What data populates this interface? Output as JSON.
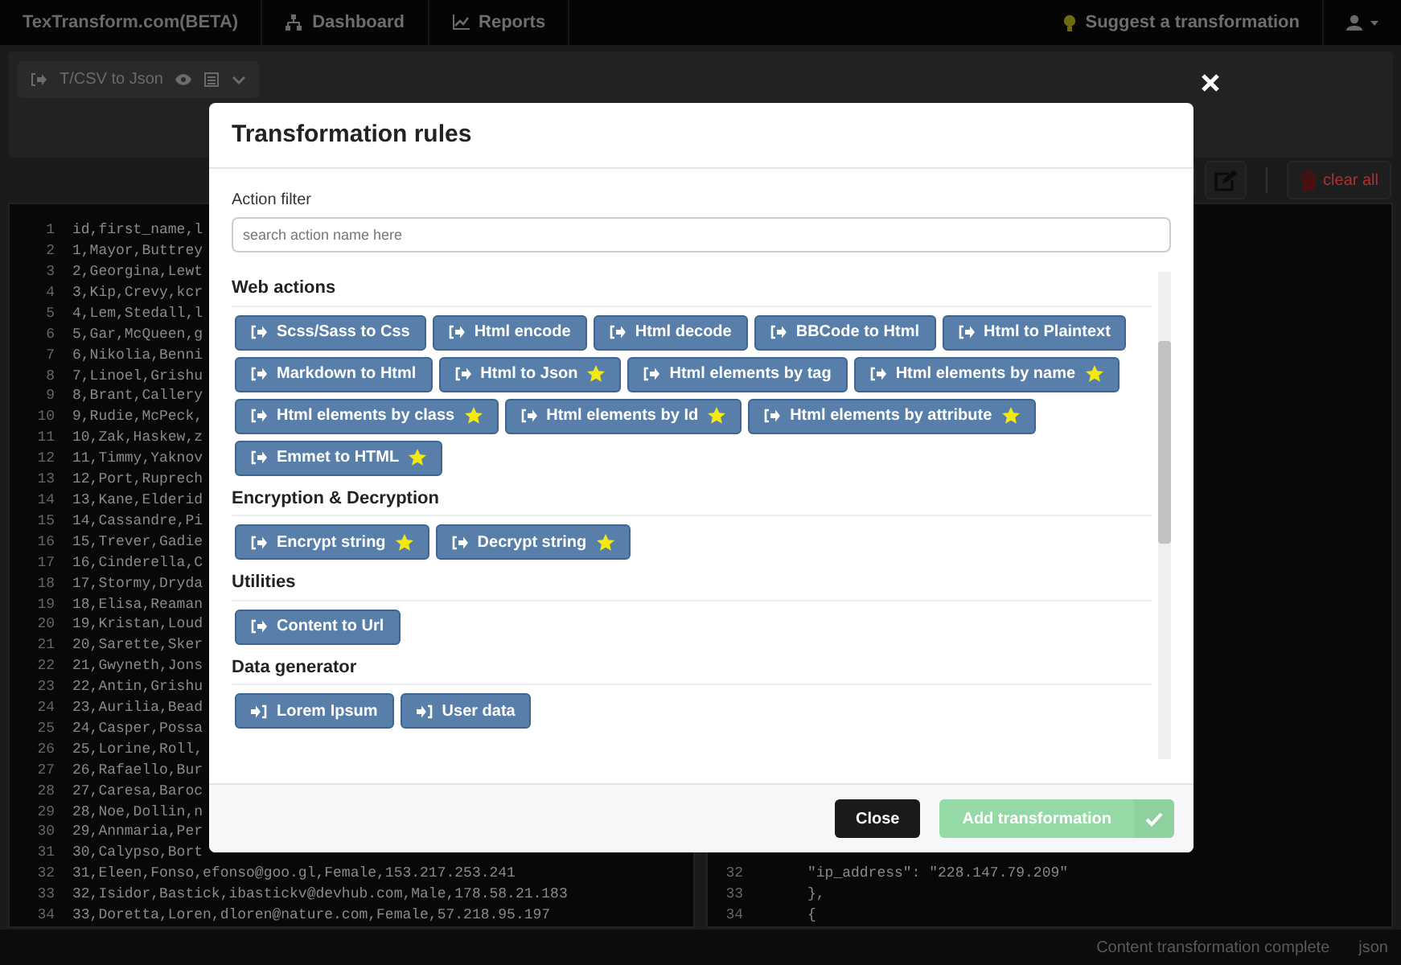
{
  "navbar": {
    "brand": "TexTransform.com(BETA)",
    "items": [
      {
        "label": "Dashboard",
        "kind": "sitemap"
      },
      {
        "label": "Reports",
        "kind": "chart"
      }
    ],
    "suggest": "Suggest a transformation"
  },
  "toolbar": {
    "transformation": "T/CSV to Json"
  },
  "editor_actions": {
    "clear": "clear all"
  },
  "input_editor": {
    "lines": [
      {
        "number": "1",
        "text": "id,first_name,l"
      },
      {
        "number": "2",
        "text": "1,Mayor,Buttrey"
      },
      {
        "number": "3",
        "text": "2,Georgina,Lewt"
      },
      {
        "number": "4",
        "text": "3,Kip,Crevy,kcr"
      },
      {
        "number": "5",
        "text": "4,Lem,Stedall,l"
      },
      {
        "number": "6",
        "text": "5,Gar,McQueen,g"
      },
      {
        "number": "7",
        "text": "6,Nikolia,Benni"
      },
      {
        "number": "8",
        "text": "7,Linoel,Grishu"
      },
      {
        "number": "9",
        "text": "8,Brant,Callery"
      },
      {
        "number": "10",
        "text": "9,Rudie,McPeck,"
      },
      {
        "number": "11",
        "text": "10,Zak,Haskew,z"
      },
      {
        "number": "12",
        "text": "11,Timmy,Yaknov"
      },
      {
        "number": "13",
        "text": "12,Port,Ruprech"
      },
      {
        "number": "14",
        "text": "13,Kane,Elderid"
      },
      {
        "number": "15",
        "text": "14,Cassandre,Pi"
      },
      {
        "number": "16",
        "text": "15,Trever,Gadie"
      },
      {
        "number": "17",
        "text": "16,Cinderella,C"
      },
      {
        "number": "18",
        "text": "17,Stormy,Dryda"
      },
      {
        "number": "19",
        "text": "18,Elisa,Reaman"
      },
      {
        "number": "20",
        "text": "19,Kristan,Loud"
      },
      {
        "number": "21",
        "text": "20,Sarette,Sker"
      },
      {
        "number": "22",
        "text": "21,Gwyneth,Jons"
      },
      {
        "number": "23",
        "text": "22,Antin,Grishu"
      },
      {
        "number": "24",
        "text": "23,Aurilia,Bead"
      },
      {
        "number": "25",
        "text": "24,Casper,Possa"
      },
      {
        "number": "26",
        "text": "25,Lorine,Roll,"
      },
      {
        "number": "27",
        "text": "26,Rafaello,Bur"
      },
      {
        "number": "28",
        "text": "27,Caresa,Baroc"
      },
      {
        "number": "29",
        "text": "28,Noe,Dollin,n"
      },
      {
        "number": "30",
        "text": "29,Annmaria,Per"
      },
      {
        "number": "31",
        "text": "30,Calypso,Bort"
      },
      {
        "number": "32",
        "text": "31,Eleen,Fonso,efonso@goo.gl,Female,153.217.253.241"
      },
      {
        "number": "33",
        "text": "32,Isidor,Bastick,ibastickv@devhub.com,Male,178.58.21.183"
      },
      {
        "number": "34",
        "text": "33,Doretta,Loren,dloren@nature.com,Female,57.218.95.197"
      }
    ]
  },
  "output_editor": {
    "lines": [
      {
        "number": "32",
        "text": "  \"ip_address\": \"228.147.79.209\""
      },
      {
        "number": "33",
        "text": "},"
      },
      {
        "number": "34",
        "text": "{"
      }
    ]
  },
  "status_bar": {
    "message": "Content transformation complete",
    "mode": "json"
  },
  "modal": {
    "title": "Transformation rules",
    "filter": {
      "label": "Action filter",
      "placeholder": "search action name here"
    },
    "groups": [
      {
        "title": "Web actions",
        "actions": [
          {
            "label": "Scss/Sass to Css",
            "kind": "export",
            "featured": false
          },
          {
            "label": "Html encode",
            "kind": "export",
            "featured": false
          },
          {
            "label": "Html decode",
            "kind": "export",
            "featured": false
          },
          {
            "label": "BBCode to Html",
            "kind": "export",
            "featured": false
          },
          {
            "label": "Html to Plaintext",
            "kind": "export",
            "featured": false
          },
          {
            "label": "Markdown to Html",
            "kind": "export",
            "featured": false
          },
          {
            "label": "Html to Json",
            "kind": "export",
            "featured": true
          },
          {
            "label": "Html elements by tag",
            "kind": "export",
            "featured": false
          },
          {
            "label": "Html elements by name",
            "kind": "export",
            "featured": true
          },
          {
            "label": "Html elements by class",
            "kind": "export",
            "featured": true
          },
          {
            "label": "Html elements by Id",
            "kind": "export",
            "featured": true
          },
          {
            "label": "Html elements by attribute",
            "kind": "export",
            "featured": true
          },
          {
            "label": "Emmet to HTML",
            "kind": "export",
            "featured": true
          }
        ]
      },
      {
        "title": "Encryption & Decryption",
        "actions": [
          {
            "label": "Encrypt string",
            "kind": "export",
            "featured": true
          },
          {
            "label": "Decrypt string",
            "kind": "export",
            "featured": true
          }
        ]
      },
      {
        "title": "Utilities",
        "actions": [
          {
            "label": "Content to Url",
            "kind": "export",
            "featured": false
          }
        ]
      },
      {
        "title": "Data generator",
        "actions": [
          {
            "label": "Lorem Ipsum",
            "kind": "import",
            "featured": false
          },
          {
            "label": "User data",
            "kind": "import",
            "featured": false
          }
        ]
      }
    ],
    "close": "Close",
    "add": {
      "label": "Add transformation",
      "disabled": true
    }
  }
}
